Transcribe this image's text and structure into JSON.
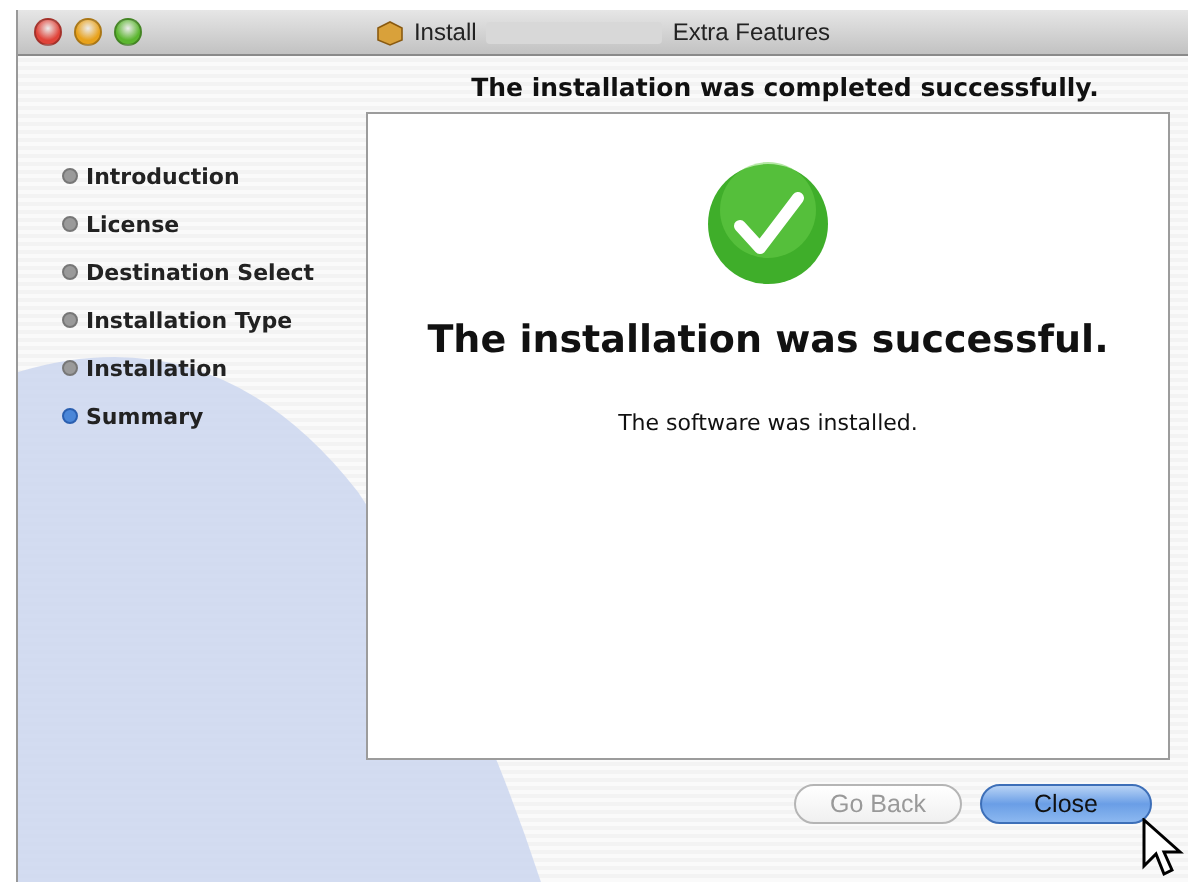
{
  "window": {
    "title_prefix": "Install",
    "title_suffix": "Extra Features"
  },
  "heading": "The installation was completed successfully.",
  "steps": [
    {
      "label": "Introduction",
      "selected": false
    },
    {
      "label": "License",
      "selected": false
    },
    {
      "label": "Destination Select",
      "selected": false
    },
    {
      "label": "Installation Type",
      "selected": false
    },
    {
      "label": "Installation",
      "selected": false
    },
    {
      "label": "Summary",
      "selected": true
    }
  ],
  "content": {
    "title": "The installation was successful.",
    "message": "The software was installed."
  },
  "buttons": [
    {
      "label": "Go Back",
      "disabled": true,
      "default": false
    },
    {
      "label": "Close",
      "disabled": false,
      "default": true
    }
  ]
}
